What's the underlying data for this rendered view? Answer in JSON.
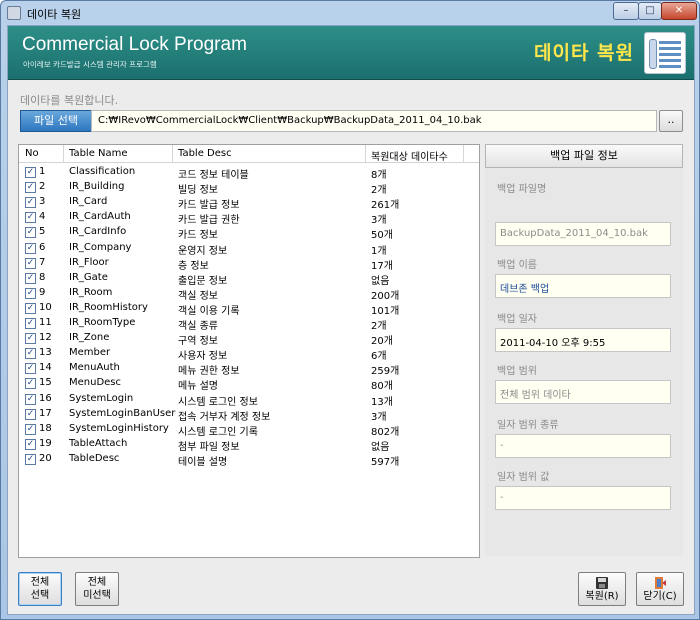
{
  "window": {
    "title": "데이타 복원",
    "min_label": "–",
    "max_label": "□",
    "close_label": "✕"
  },
  "banner": {
    "title": "Commercial Lock Program",
    "subtitle": "아이레보 카드발급 시스템 관리자 프로그램",
    "heading": "데이타 복원"
  },
  "instruction": "데이타를 복원합니다.",
  "file": {
    "select_label": "파일 선택",
    "path": "C:₩IRevo₩CommercialLock₩Client₩Backup₩BackupData_2011_04_10.bak",
    "browse_label": ".."
  },
  "table": {
    "columns": [
      "No",
      "Table Name",
      "Table Desc",
      "복원대상 데이타수"
    ],
    "rows": [
      {
        "no": "1",
        "name": "Classification",
        "desc": "코드 정보 테이블",
        "count": "8개"
      },
      {
        "no": "2",
        "name": "IR_Building",
        "desc": "빌딩 정보",
        "count": "2개"
      },
      {
        "no": "3",
        "name": "IR_Card",
        "desc": "카드 발급 정보",
        "count": "261개"
      },
      {
        "no": "4",
        "name": "IR_CardAuth",
        "desc": "카드 발급 권한",
        "count": "3개"
      },
      {
        "no": "5",
        "name": "IR_CardInfo",
        "desc": "카드 정보",
        "count": "50개"
      },
      {
        "no": "6",
        "name": "IR_Company",
        "desc": "운영지 정보",
        "count": "1개"
      },
      {
        "no": "7",
        "name": "IR_Floor",
        "desc": "층 정보",
        "count": "17개"
      },
      {
        "no": "8",
        "name": "IR_Gate",
        "desc": "출입문 정보",
        "count": "없음"
      },
      {
        "no": "9",
        "name": "IR_Room",
        "desc": "객실 정보",
        "count": "200개"
      },
      {
        "no": "10",
        "name": "IR_RoomHistory",
        "desc": "객실 이용 기록",
        "count": "101개"
      },
      {
        "no": "11",
        "name": "IR_RoomType",
        "desc": "객실 종류",
        "count": "2개"
      },
      {
        "no": "12",
        "name": "IR_Zone",
        "desc": "구역 정보",
        "count": "20개"
      },
      {
        "no": "13",
        "name": "Member",
        "desc": "사용자 정보",
        "count": "6개"
      },
      {
        "no": "14",
        "name": "MenuAuth",
        "desc": "메뉴 권한 정보",
        "count": "259개"
      },
      {
        "no": "15",
        "name": "MenuDesc",
        "desc": "메뉴 설명",
        "count": "80개"
      },
      {
        "no": "16",
        "name": "SystemLogin",
        "desc": "시스템 로그인 정보",
        "count": "13개"
      },
      {
        "no": "17",
        "name": "SystemLoginBanUser",
        "desc": "접속 거부자 계정 정보",
        "count": "3개"
      },
      {
        "no": "18",
        "name": "SystemLoginHistory",
        "desc": "시스템 로그인 기록",
        "count": "802개"
      },
      {
        "no": "19",
        "name": "TableAttach",
        "desc": "첨부 파일 정보",
        "count": "없음"
      },
      {
        "no": "20",
        "name": "TableDesc",
        "desc": "테이블 설명",
        "count": "597개"
      }
    ]
  },
  "info": {
    "header": "백업 파일 정보",
    "file_name_label": "백업 파일명",
    "file_name": "BackupData_2011_04_10.bak",
    "backup_name_label": "백업 이름",
    "backup_name": "데브존 백업",
    "backup_date_label": "백업 일자",
    "backup_date": "2011-04-10 오후 9:55",
    "backup_range_label": "백업 범위",
    "backup_range": "전체 범위 데이타",
    "date_range_type_label": "일자 범위 종류",
    "date_range_type": "-",
    "date_range_value_label": "일자 범위 값",
    "date_range_value": "-"
  },
  "buttons": {
    "select_all_1": "전체",
    "select_all_2": "선택",
    "deselect_all_1": "전체",
    "deselect_all_2": "미선택",
    "restore": "복원(R)",
    "close": "닫기(C)"
  },
  "colors": {
    "banner": "#1f7a78",
    "banner_heading": "#ffe64a",
    "accent_button": "#2d76c0"
  }
}
